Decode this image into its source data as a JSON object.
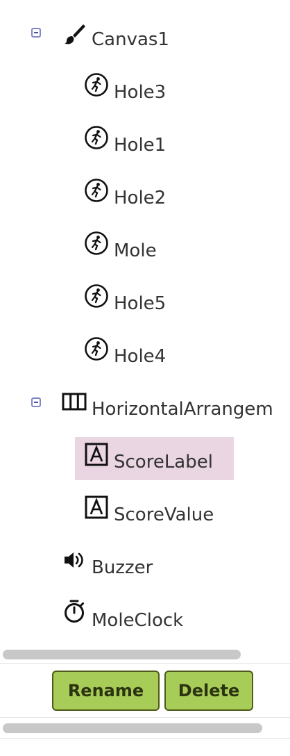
{
  "tree": {
    "canvas": {
      "label": "Canvas1",
      "icon": "paintbrush-icon",
      "children": [
        {
          "label": "Hole3",
          "icon": "sprite-runner-icon"
        },
        {
          "label": "Hole1",
          "icon": "sprite-runner-icon"
        },
        {
          "label": "Hole2",
          "icon": "sprite-runner-icon"
        },
        {
          "label": "Mole",
          "icon": "sprite-runner-icon"
        },
        {
          "label": "Hole5",
          "icon": "sprite-runner-icon"
        },
        {
          "label": "Hole4",
          "icon": "sprite-runner-icon"
        }
      ]
    },
    "arrangement": {
      "label": "HorizontalArrangem",
      "icon": "horizontal-arrangement-icon",
      "children": [
        {
          "label": "ScoreLabel",
          "icon": "label-a-icon",
          "selected": true
        },
        {
          "label": "ScoreValue",
          "icon": "label-a-icon"
        }
      ]
    },
    "buzzer": {
      "label": "Buzzer",
      "icon": "speaker-icon"
    },
    "clock": {
      "label": "MoleClock",
      "icon": "stopwatch-icon"
    }
  },
  "buttons": {
    "rename": "Rename",
    "delete": "Delete"
  },
  "colors": {
    "selected_background": "#ead5e2",
    "button_background": "#a7cc57",
    "button_border": "#4e5a18",
    "collapse_border": "#7f86c9"
  }
}
